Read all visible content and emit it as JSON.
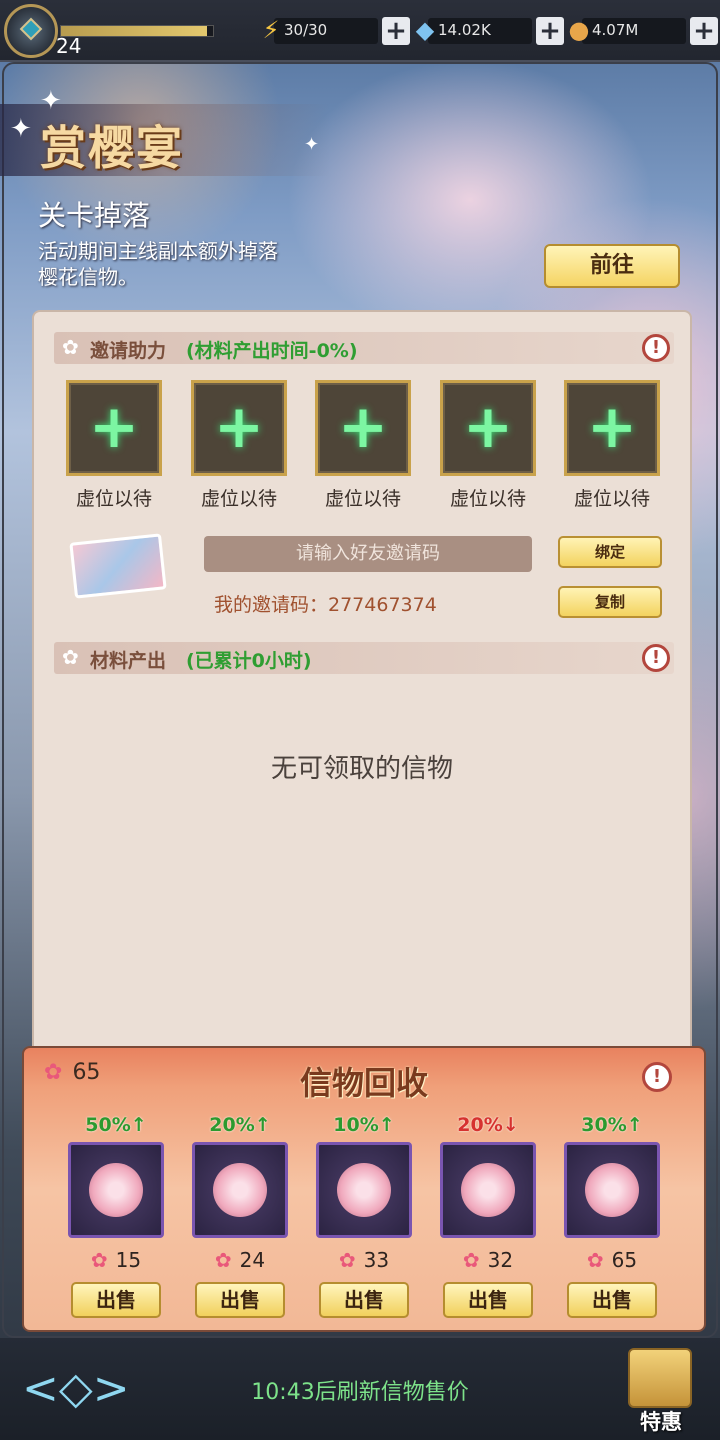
{
  "player": {
    "level": "24",
    "xp_fraction": 0.96
  },
  "resources": {
    "energy": {
      "value": "30/30",
      "icon": "lightning-icon",
      "color": "#f5c542"
    },
    "diamonds": {
      "value": "14.02K",
      "icon": "diamond-icon",
      "color": "#7fc3f0"
    },
    "coins": {
      "value": "4.07M",
      "icon": "coin-icon",
      "color": "#e8a64a"
    }
  },
  "event": {
    "title": "赏樱宴",
    "subtitle": "关卡掉落",
    "description": "活动期间主线副本额外掉落樱花信物。",
    "goto_label": "前往"
  },
  "invite": {
    "header": "邀请助力",
    "header_note": "(材料产出时间-0%)",
    "slots": [
      "虚位以待",
      "虚位以待",
      "虚位以待",
      "虚位以待",
      "虚位以待"
    ],
    "input_placeholder": "请输入好友邀请码",
    "my_code_label": "我的邀请码：277467374",
    "bind_label": "绑定",
    "copy_label": "复制"
  },
  "material": {
    "header": "材料产出",
    "header_note": "(已累计0小时)",
    "empty_text": "无可领取的信物"
  },
  "recycle": {
    "title": "信物回收",
    "balance": "65",
    "items": [
      {
        "change": "50%↑",
        "direction": "up",
        "price": "15",
        "sell": "出售"
      },
      {
        "change": "20%↑",
        "direction": "up",
        "price": "24",
        "sell": "出售"
      },
      {
        "change": "10%↑",
        "direction": "up",
        "price": "33",
        "sell": "出售"
      },
      {
        "change": "20%↓",
        "direction": "down",
        "price": "32",
        "sell": "出售"
      },
      {
        "change": "30%↑",
        "direction": "up",
        "price": "65",
        "sell": "出售"
      }
    ]
  },
  "footer": {
    "refresh_text": "10:43后刷新信物售价",
    "special_label": "特惠"
  }
}
